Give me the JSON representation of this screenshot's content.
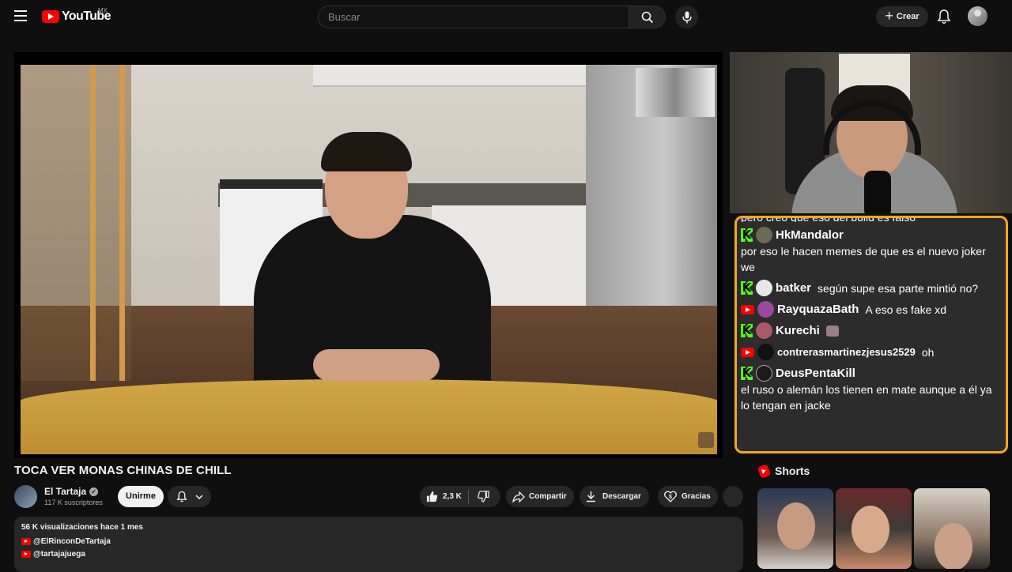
{
  "header": {
    "logo_text": "YouTube",
    "region": "MX",
    "search_placeholder": "Buscar",
    "create_label": "Crear"
  },
  "video": {
    "title": "TOCA VER MONAS CHINAS DE CHILL"
  },
  "channel": {
    "name": "El Tartaja",
    "subscribers": "117 K suscriptores",
    "join_label": "Unirme"
  },
  "actions": {
    "likes": "2,3 K",
    "share_label": "Compartir",
    "download_label": "Descargar",
    "thanks_label": "Gracias"
  },
  "description": {
    "stats": "56 K visualizaciones  hace 1 mes",
    "links": [
      "@ElRinconDeTartaja",
      "@tartajajuega"
    ]
  },
  "chat": {
    "cut_text": "pero creo que eso del build es falso",
    "messages": [
      {
        "platform": "kick",
        "user": "HkMandalor",
        "text": "por eso le hacen memes de que es el nuevo joker we",
        "avatar_color": "#6a6a55"
      },
      {
        "platform": "kick",
        "user": "batker",
        "text": "según supe esa parte mintió no?",
        "avatar_color": "#e8e8e8"
      },
      {
        "platform": "youtube",
        "user": "RayquazaBath",
        "text": "A eso es fake xd",
        "avatar_color": "#9a4a9a"
      },
      {
        "platform": "kick",
        "user": "Kurechi",
        "text": "",
        "avatar_color": "#a85a6a"
      },
      {
        "platform": "youtube",
        "user": "contrerasmartinezjesus2529",
        "text": "oh",
        "avatar_color": "#111111"
      },
      {
        "platform": "kick",
        "user": "DeusPentaKill",
        "text": "el ruso o alemán los tienen en mate aunque a él ya lo tengan en jacke",
        "avatar_color": "#1a1a1a"
      }
    ]
  },
  "shorts": {
    "label": "Shorts"
  },
  "colors": {
    "background": "#0f0f0f",
    "chat_border": "#f5a623",
    "kick_green": "#53fc18",
    "youtube_red": "#ff0000"
  }
}
